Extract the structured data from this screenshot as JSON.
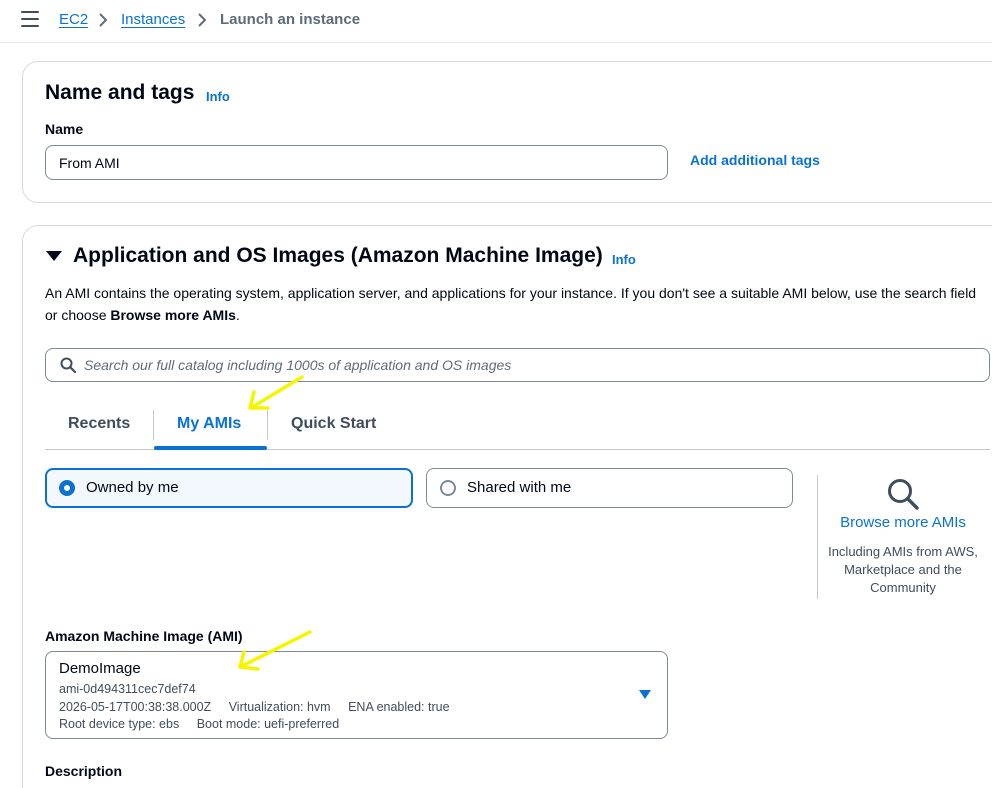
{
  "breadcrumb": {
    "items": [
      "EC2",
      "Instances"
    ],
    "current": "Launch an instance"
  },
  "name_and_tags": {
    "title": "Name and tags",
    "info": "Info",
    "name_label": "Name",
    "name_value": "From AMI",
    "add_tags": "Add additional tags"
  },
  "ami_section": {
    "title": "Application and OS Images (Amazon Machine Image)",
    "info": "Info",
    "description_prefix": "An AMI contains the operating system, application server, and applications for your instance. If you don't see a suitable AMI below, use the search field or choose ",
    "description_bold": "Browse more AMIs",
    "description_suffix": ".",
    "search_placeholder": "Search our full catalog including 1000s of application and OS images",
    "tabs": [
      {
        "label": "Recents",
        "active": false
      },
      {
        "label": "My AMIs",
        "active": true
      },
      {
        "label": "Quick Start",
        "active": false
      }
    ],
    "ownership": {
      "owned": "Owned by me",
      "shared": "Shared with me",
      "selected": "Owned by me"
    },
    "browse": {
      "link": "Browse more AMIs",
      "subtext": "Including AMIs from AWS, Marketplace and the Community"
    },
    "ami_label": "Amazon Machine Image (AMI)",
    "selected_ami": {
      "name": "DemoImage",
      "id": "ami-0d494311cec7def74",
      "created": "2026-05-17T00:38:38.000Z",
      "virtualization": "Virtualization: hvm",
      "ena": "ENA enabled: true",
      "root_device": "Root device type: ebs",
      "boot_mode": "Boot mode: uefi-preferred"
    },
    "description_label": "Description"
  },
  "colors": {
    "link": "#0972d3",
    "text": "#000716",
    "border": "#7d8998",
    "annotation_arrow": "#f5f500"
  },
  "icons": [
    "menu-icon",
    "chevron-right-icon",
    "caret-down-icon",
    "search-icon",
    "magnifier-icon",
    "dropdown-caret-icon",
    "annotation-arrow"
  ]
}
